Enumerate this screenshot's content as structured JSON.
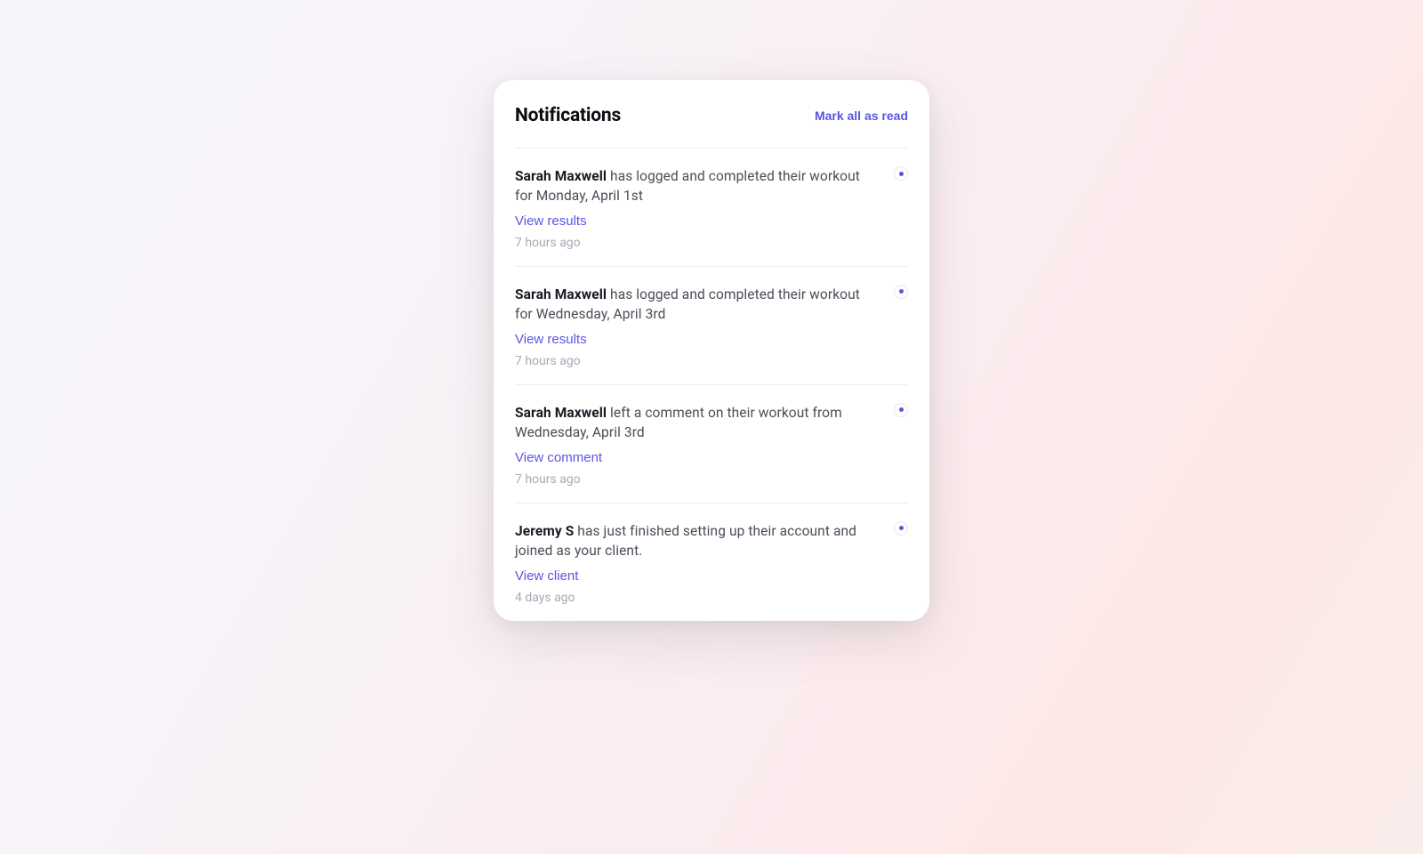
{
  "header": {
    "title": "Notifications",
    "mark_all": "Mark all as read"
  },
  "notifications": [
    {
      "subject": "Sarah Maxwell",
      "body": " has logged and completed their workout for Monday, April 1st",
      "action_label": "View results",
      "time": "7 hours ago"
    },
    {
      "subject": "Sarah Maxwell",
      "body": " has logged and completed their workout for Wednesday, April 3rd",
      "action_label": "View results",
      "time": "7 hours ago"
    },
    {
      "subject": "Sarah Maxwell",
      "body": " left a comment on their workout from Wednesday, April 3rd",
      "action_label": "View comment",
      "time": "7 hours ago"
    },
    {
      "subject": "Jeremy S",
      "body": " has just finished setting up their account and joined as your client.",
      "action_label": "View client",
      "time": "4 days ago"
    }
  ]
}
